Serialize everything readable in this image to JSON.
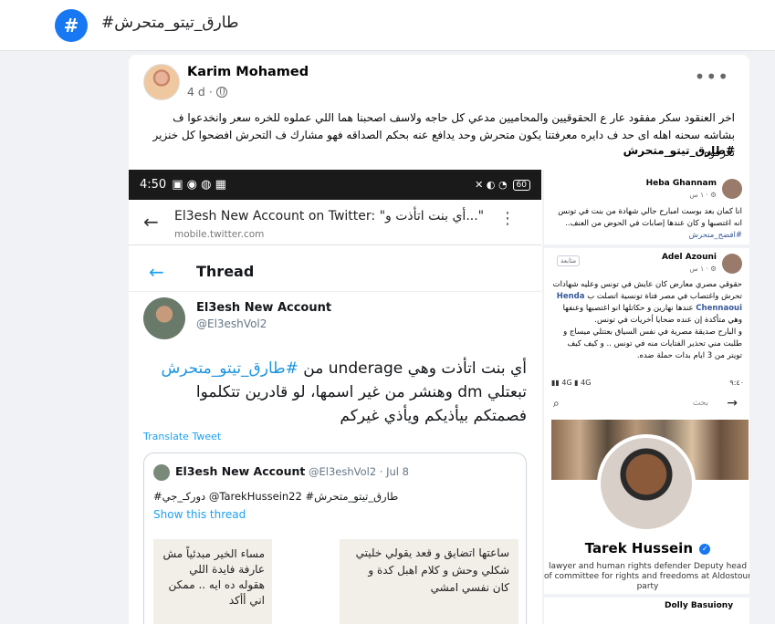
{
  "hashtag_page": {
    "icon": "#",
    "title": "#طارق_تيتو_متحرش"
  },
  "post": {
    "author": "Karim Mohamed",
    "time": "4 d",
    "privacy_icon": "globe-icon",
    "more_icon": "•••",
    "text": "اخر العنقود سكر مفقود عار ع الحقوقيين والمحاميين مدعي كل حاجه ولاسف اصحبنا هما اللي عملوه للخره سعر وانخدعوا ف بشاشه سحنه اهله اى حد ف دايره معرفتنا يكون متحرش وحد يدافع عنه بحكم الصداقه فهو مشارك ف التحرش افضحوا كل خنزير تعرفوه",
    "tag": "#طارق_تيتو_متحرش"
  },
  "left_screenshot": {
    "status_time": "4:50",
    "battery": "60",
    "url_title": "El3esh New Account on Twitter: \"أي بنت اتأذت و...\"",
    "url_host": "mobile.twitter.com",
    "thread_title": "Thread",
    "tweet_name": "El3esh New Account",
    "tweet_handle": "@El3eshVol2",
    "tweet_text_1": "أي بنت اتأذت وهي underage من ",
    "tweet_hashtag": "#طارق_تيتو_متحرش",
    "tweet_text_2": "تبعتلي dm وهنشر من غير اسمها، لو قادرين تتكلموا فصمتكم بيأذيكم ويأذي غيركم",
    "translate": "Translate Tweet",
    "quote_name": "El3esh New Account",
    "quote_handle": "@El3eshVol2 · Jul 8",
    "quote_text": "#دوركـ_جي @TarekHussein22 #طارق_تيتو_متحرش",
    "show_thread": "Show this thread",
    "img_a_text": "مساء الخير مبدئياً مش عارفة فايدة اللي هقوله ده ايه .. ممكن اني أأكد",
    "img_b_text": "ساعتها اتضايق و قعد يقولي خليتي شكلي وحش و كلام اهبل كدة و كان نفسي امشي"
  },
  "right_top": {
    "c1_name": "Heba Ghannam",
    "c1_time": "١ س · ⚙",
    "c1_text": "انا كمان بعد بوست امبارح جالي شهادة من بنت في تونس انه اغتصبها و كان عندها إصابات في الحوض من العنف..",
    "c1_tag": "#افضح_متحرش",
    "c2_name": "Adel Azouni",
    "c2_time": "١ س · ⚙",
    "c2_badge": "متابعة",
    "c2_text_1": "حقوقي مصري معارض كان عايش في تونس وعليه شهادات تحرش واغتصاب في مصر فتاة تونسية اتصلت ب",
    "c2_link": "Henda Chennaoui",
    "c2_text_2": "عندها نهارين و حكاتلها انو اغتصبها وعنفها وهي متأكدة إن عنده ضحايا أخريات في تونس.",
    "c2_text_3": "و البارح صديقة مصرية في نفس السياق بعتتلي ميساج و طلبت مني تحذير الفتايات منه في تونس .. و كيف كيف تويتر من 3 ايام بدات حملة ضده."
  },
  "right_bottom": {
    "status": "٩:٤٠",
    "search_placeholder": "بحث",
    "profile_name": "Tarek Hussein",
    "verified_icon": "✓",
    "bio": "lawyer and human rights defender Deputy head of committee for rights and freedoms at Aldostour party",
    "next_name": "Dolly Basuiony"
  }
}
